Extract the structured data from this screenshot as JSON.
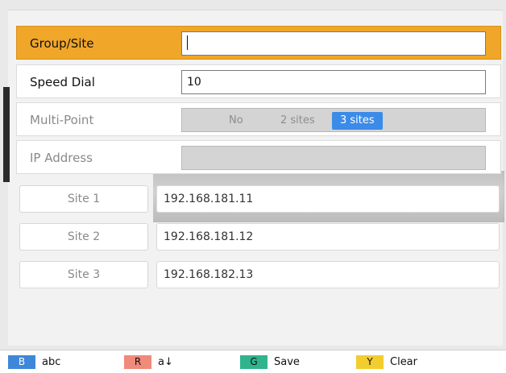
{
  "form": {
    "group_site": {
      "label": "Group/Site",
      "value": ""
    },
    "speed_dial": {
      "label": "Speed Dial",
      "value": "10"
    },
    "multi_point": {
      "label": "Multi-Point",
      "options": [
        "No",
        "2 sites",
        "3 sites"
      ],
      "selected": "3 sites"
    },
    "ip_address": {
      "label": "IP Address",
      "value": ""
    }
  },
  "sites": [
    {
      "label": "Site 1",
      "ip": "192.168.181.11"
    },
    {
      "label": "Site 2",
      "ip": "192.168.181.12"
    },
    {
      "label": "Site 3",
      "ip": "192.168.182.13"
    }
  ],
  "footer": [
    {
      "key": "B",
      "label": "abc",
      "color": "#3f87d9"
    },
    {
      "key": "R",
      "label": "a↓",
      "color": "#f08a7a"
    },
    {
      "key": "G",
      "label": "Save",
      "color": "#2fb48e"
    },
    {
      "key": "Y",
      "label": "Clear",
      "color": "#f2cd2e"
    }
  ],
  "colors": {
    "selected_row": "#f0a629",
    "active_option": "#3b8be8"
  }
}
